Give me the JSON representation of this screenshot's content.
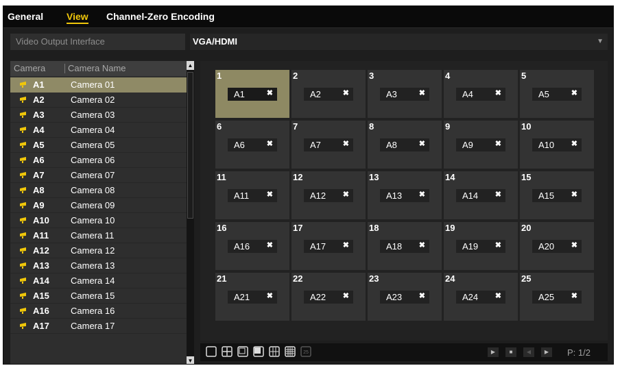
{
  "tabs": [
    "General",
    "View",
    "Channel-Zero Encoding"
  ],
  "active_tab": "View",
  "colors": {
    "accent": "#f0c70a",
    "selected_bg": "#8e8963",
    "panel_bg": "#1e1e1e"
  },
  "output": {
    "label": "Video Output Interface",
    "value": "VGA/HDMI"
  },
  "camera_list": {
    "headers": [
      "Camera",
      "Camera Name"
    ],
    "rows": [
      {
        "id": "A1",
        "name": "Camera 01",
        "selected": true
      },
      {
        "id": "A2",
        "name": "Camera 02"
      },
      {
        "id": "A3",
        "name": "Camera 03"
      },
      {
        "id": "A4",
        "name": "Camera 04"
      },
      {
        "id": "A5",
        "name": "Camera 05"
      },
      {
        "id": "A6",
        "name": "Camera 06"
      },
      {
        "id": "A7",
        "name": "Camera 07"
      },
      {
        "id": "A8",
        "name": "Camera 08"
      },
      {
        "id": "A9",
        "name": "Camera 09"
      },
      {
        "id": "A10",
        "name": "Camera 10"
      },
      {
        "id": "A11",
        "name": "Camera 11"
      },
      {
        "id": "A12",
        "name": "Camera 12"
      },
      {
        "id": "A13",
        "name": "Camera 13"
      },
      {
        "id": "A14",
        "name": "Camera 14"
      },
      {
        "id": "A15",
        "name": "Camera 15"
      },
      {
        "id": "A16",
        "name": "Camera 16"
      },
      {
        "id": "A17",
        "name": "Camera 17"
      }
    ]
  },
  "grid": {
    "columns": 5,
    "selected_cell": 1,
    "cells": [
      {
        "num": "1",
        "camera": "A1"
      },
      {
        "num": "2",
        "camera": "A2"
      },
      {
        "num": "3",
        "camera": "A3"
      },
      {
        "num": "4",
        "camera": "A4"
      },
      {
        "num": "5",
        "camera": "A5"
      },
      {
        "num": "6",
        "camera": "A6"
      },
      {
        "num": "7",
        "camera": "A7"
      },
      {
        "num": "8",
        "camera": "A8"
      },
      {
        "num": "9",
        "camera": "A9"
      },
      {
        "num": "10",
        "camera": "A10"
      },
      {
        "num": "11",
        "camera": "A11"
      },
      {
        "num": "12",
        "camera": "A12"
      },
      {
        "num": "13",
        "camera": "A13"
      },
      {
        "num": "14",
        "camera": "A14"
      },
      {
        "num": "15",
        "camera": "A15"
      },
      {
        "num": "16",
        "camera": "A16"
      },
      {
        "num": "17",
        "camera": "A17"
      },
      {
        "num": "18",
        "camera": "A18"
      },
      {
        "num": "19",
        "camera": "A19"
      },
      {
        "num": "20",
        "camera": "A20"
      },
      {
        "num": "21",
        "camera": "A21"
      },
      {
        "num": "22",
        "camera": "A22"
      },
      {
        "num": "23",
        "camera": "A23"
      },
      {
        "num": "24",
        "camera": "A24"
      },
      {
        "num": "25",
        "camera": "A25"
      }
    ],
    "remove_glyph": "✖"
  },
  "layout_buttons": [
    {
      "name": "layout-1-icon"
    },
    {
      "name": "layout-4-icon"
    },
    {
      "name": "layout-6-icon"
    },
    {
      "name": "layout-8-icon"
    },
    {
      "name": "layout-9-icon"
    },
    {
      "name": "layout-16-icon"
    },
    {
      "name": "layout-25-icon",
      "text": "25"
    }
  ],
  "paging": {
    "indicator": "P: 1/2"
  }
}
